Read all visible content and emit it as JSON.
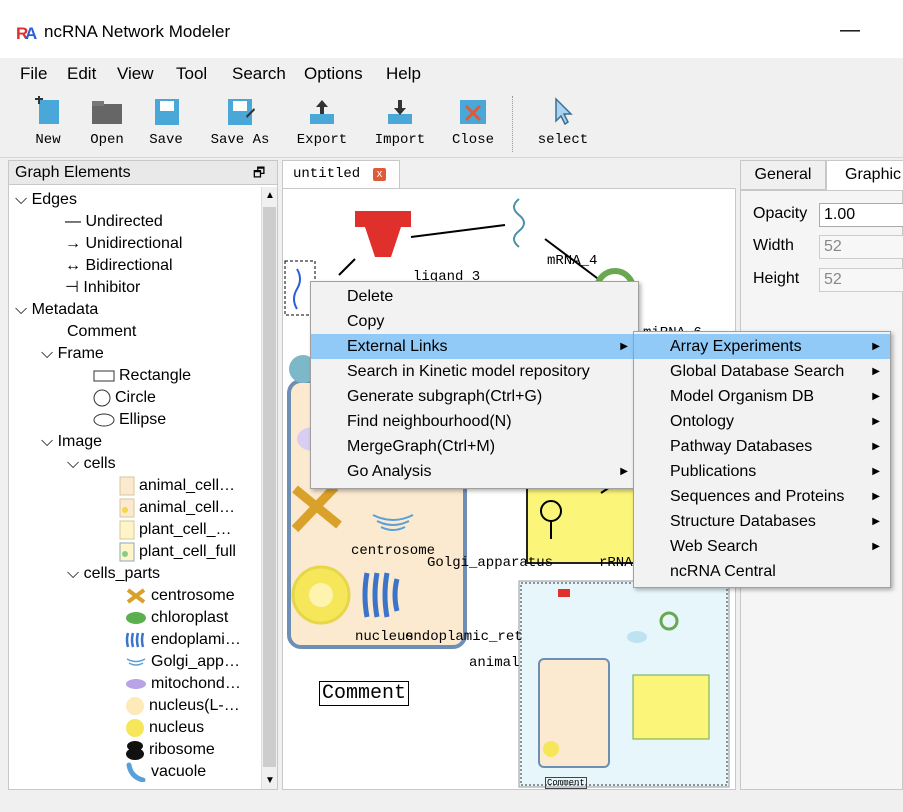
{
  "window": {
    "title": "ncRNA Network Modeler",
    "minimize": "—"
  },
  "menu": [
    "File",
    "Edit",
    "View",
    "Tool",
    "Search",
    "Options",
    "Help"
  ],
  "toolbar": {
    "new": "New",
    "open": "Open",
    "save": "Save",
    "save_as": "Save As",
    "export": "Export",
    "import": "Import",
    "close": "Close",
    "select": "select"
  },
  "left_panel": {
    "title": "Graph Elements",
    "float_icon": "🗗",
    "edges": "Edges",
    "edge_items": [
      "Undirected",
      "Unidirectional",
      "Bidirectional",
      "Inhibitor"
    ],
    "edge_symbols": [
      "—",
      "→",
      "↔",
      "⊣"
    ],
    "metadata": "Metadata",
    "comment": "Comment",
    "frame": "Frame",
    "frame_items": [
      "Rectangle",
      "Circle",
      "Ellipse"
    ],
    "image": "Image",
    "cells": "cells",
    "cell_items": [
      "animal_cell…",
      "animal_cell…",
      "plant_cell_…",
      "plant_cell_full"
    ],
    "cells_parts": "cells_parts",
    "part_items": [
      "centrosome",
      "chloroplast",
      "endoplami…",
      "Golgi_app…",
      "mitochond…",
      "nucleus(L-…",
      "nucleus",
      "ribosome",
      "vacuole"
    ]
  },
  "canvas": {
    "tab": "untitled",
    "tab_close": "x",
    "labels": {
      "ligand": "ligand_3",
      "mrna": "mRNA_4",
      "mirna": "miRNA_6",
      "centrosome": "centrosome",
      "golgi": "Golgi_apparatus",
      "rrna": "rRNA",
      "nucleus": "nucleus",
      "endo": "endoplamic_ret",
      "animal": "animal",
      "comment": "Comment",
      "mini_comment": "Comment"
    }
  },
  "right_panel": {
    "tab_general": "General",
    "tab_graphics": "Graphic",
    "opacity_label": "Opacity",
    "opacity_value": "1.00",
    "width_label": "Width",
    "width_value": "52",
    "height_label": "Height",
    "height_value": "52"
  },
  "context_menu": {
    "items": [
      "Delete",
      "Copy",
      "External Links",
      "Search in Kinetic model repository",
      "Generate subgraph(Ctrl+G)",
      "Find neighbourhood(N)",
      "MergeGraph(Ctrl+M)",
      "Go Analysis"
    ],
    "submenu_arrow": "▶"
  },
  "submenu": {
    "items": [
      "Array Experiments",
      "Global Database Search",
      "Model Organism DB",
      "Ontology",
      "Pathway Databases",
      "Publications",
      "Sequences and Proteins",
      "Structure Databases",
      "Web Search",
      "ncRNA Central"
    ]
  },
  "colors": {
    "highlight": "#91c9f7",
    "accent_red": "#e0302b",
    "nucleus_yellow": "#f5e65a",
    "cell_bg": "#fbe9d0"
  }
}
